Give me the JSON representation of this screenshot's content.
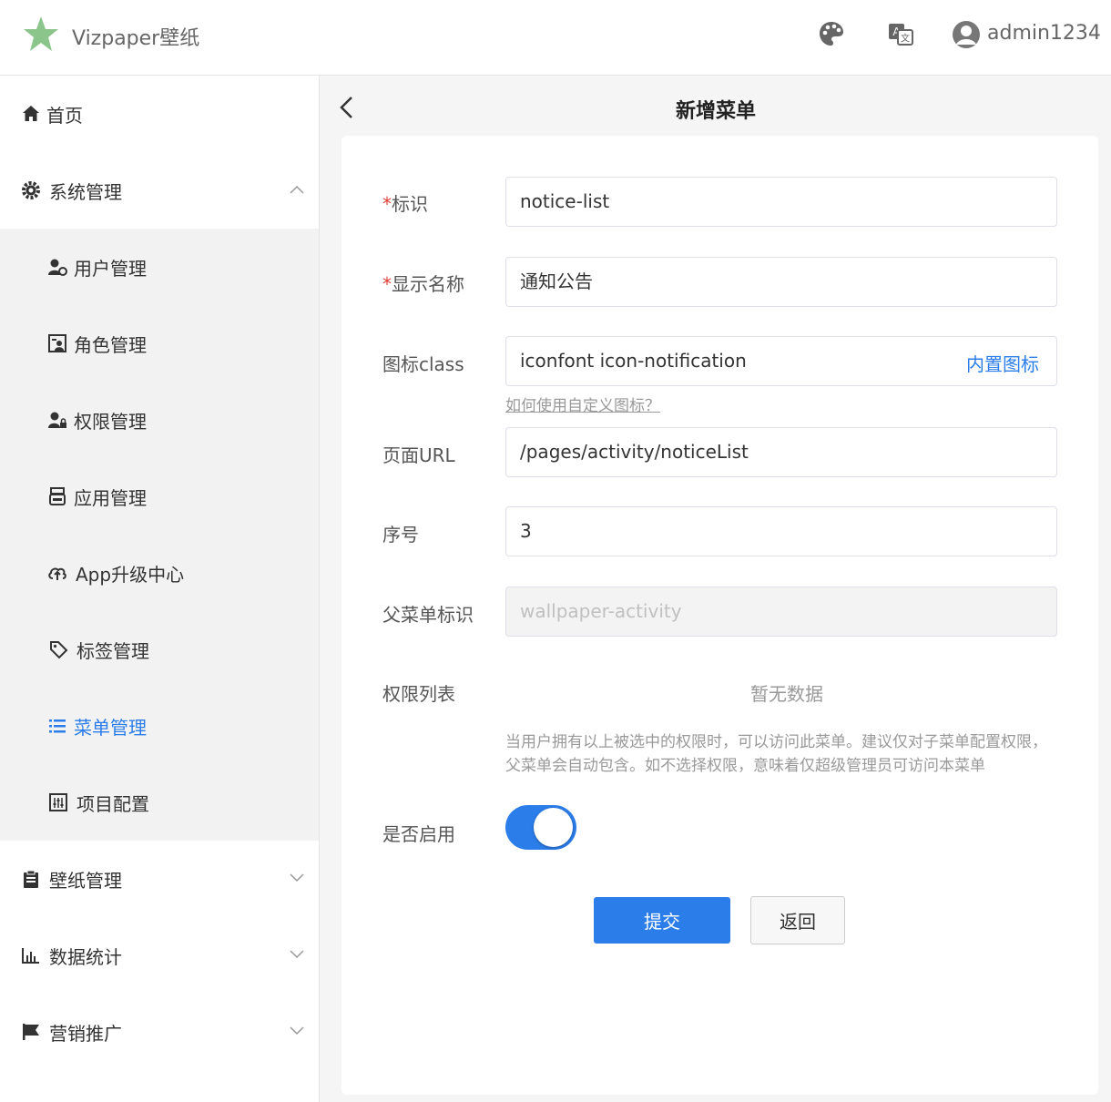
{
  "topbar": {
    "title": "Vizpaper壁纸",
    "username": "admin1234"
  },
  "colors": {
    "accent": "#2b7de9",
    "required": "#e43d33"
  },
  "sidebar": {
    "items": [
      {
        "label": "首页",
        "icon": "home-icon"
      },
      {
        "label": "系统管理",
        "icon": "gear-icon",
        "expanded": true
      },
      {
        "label": "用户管理",
        "icon": "user-gear-icon"
      },
      {
        "label": "角色管理",
        "icon": "role-icon"
      },
      {
        "label": "权限管理",
        "icon": "user-lock-icon"
      },
      {
        "label": "应用管理",
        "icon": "app-icon"
      },
      {
        "label": "App升级中心",
        "icon": "cloud-upload-icon"
      },
      {
        "label": "标签管理",
        "icon": "tag-icon"
      },
      {
        "label": "菜单管理",
        "icon": "list-icon",
        "active": true
      },
      {
        "label": "项目配置",
        "icon": "config-icon"
      },
      {
        "label": "壁纸管理",
        "icon": "clipboard-icon"
      },
      {
        "label": "数据统计",
        "icon": "bar-chart-icon"
      },
      {
        "label": "营销推广",
        "icon": "flag-icon"
      }
    ]
  },
  "page": {
    "title": "新增菜单",
    "required_mark": "*",
    "fields": {
      "identifier": {
        "label": "标识",
        "value": "notice-list"
      },
      "display_name": {
        "label": "显示名称",
        "value": "通知公告"
      },
      "icon_class": {
        "label": "图标class",
        "value": "iconfont icon-notification",
        "builtin_link": "内置图标",
        "help_link": "如何使用自定义图标？"
      },
      "page_url": {
        "label": "页面URL",
        "value": "/pages/activity/noticeList"
      },
      "order": {
        "label": "序号",
        "value": "3"
      },
      "parent_id": {
        "label": "父菜单标识",
        "value": "wallpaper-activity"
      },
      "permissions": {
        "label": "权限列表",
        "empty": "暂无数据",
        "hint": "当用户拥有以上被选中的权限时，可以访问此菜单。建议仅对子菜单配置权限，父菜单会自动包含。如不选择权限，意味着仅超级管理员可访问本菜单"
      },
      "enabled": {
        "label": "是否启用",
        "value": true
      }
    },
    "buttons": {
      "submit": "提交",
      "back": "返回"
    }
  }
}
